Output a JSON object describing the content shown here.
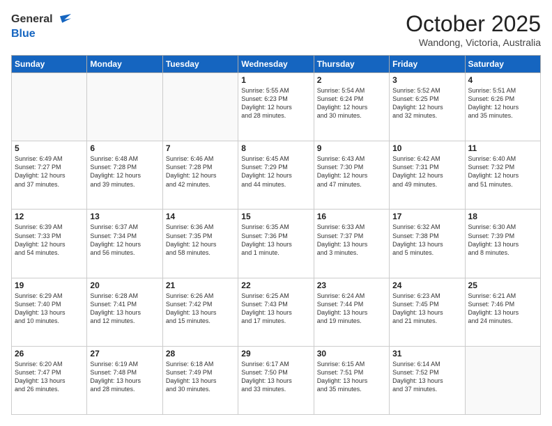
{
  "header": {
    "logo_general": "General",
    "logo_blue": "Blue",
    "month_title": "October 2025",
    "location": "Wandong, Victoria, Australia"
  },
  "days_of_week": [
    "Sunday",
    "Monday",
    "Tuesday",
    "Wednesday",
    "Thursday",
    "Friday",
    "Saturday"
  ],
  "weeks": [
    [
      {
        "day": "",
        "info": ""
      },
      {
        "day": "",
        "info": ""
      },
      {
        "day": "",
        "info": ""
      },
      {
        "day": "1",
        "info": "Sunrise: 5:55 AM\nSunset: 6:23 PM\nDaylight: 12 hours\nand 28 minutes."
      },
      {
        "day": "2",
        "info": "Sunrise: 5:54 AM\nSunset: 6:24 PM\nDaylight: 12 hours\nand 30 minutes."
      },
      {
        "day": "3",
        "info": "Sunrise: 5:52 AM\nSunset: 6:25 PM\nDaylight: 12 hours\nand 32 minutes."
      },
      {
        "day": "4",
        "info": "Sunrise: 5:51 AM\nSunset: 6:26 PM\nDaylight: 12 hours\nand 35 minutes."
      }
    ],
    [
      {
        "day": "5",
        "info": "Sunrise: 6:49 AM\nSunset: 7:27 PM\nDaylight: 12 hours\nand 37 minutes."
      },
      {
        "day": "6",
        "info": "Sunrise: 6:48 AM\nSunset: 7:28 PM\nDaylight: 12 hours\nand 39 minutes."
      },
      {
        "day": "7",
        "info": "Sunrise: 6:46 AM\nSunset: 7:28 PM\nDaylight: 12 hours\nand 42 minutes."
      },
      {
        "day": "8",
        "info": "Sunrise: 6:45 AM\nSunset: 7:29 PM\nDaylight: 12 hours\nand 44 minutes."
      },
      {
        "day": "9",
        "info": "Sunrise: 6:43 AM\nSunset: 7:30 PM\nDaylight: 12 hours\nand 47 minutes."
      },
      {
        "day": "10",
        "info": "Sunrise: 6:42 AM\nSunset: 7:31 PM\nDaylight: 12 hours\nand 49 minutes."
      },
      {
        "day": "11",
        "info": "Sunrise: 6:40 AM\nSunset: 7:32 PM\nDaylight: 12 hours\nand 51 minutes."
      }
    ],
    [
      {
        "day": "12",
        "info": "Sunrise: 6:39 AM\nSunset: 7:33 PM\nDaylight: 12 hours\nand 54 minutes."
      },
      {
        "day": "13",
        "info": "Sunrise: 6:37 AM\nSunset: 7:34 PM\nDaylight: 12 hours\nand 56 minutes."
      },
      {
        "day": "14",
        "info": "Sunrise: 6:36 AM\nSunset: 7:35 PM\nDaylight: 12 hours\nand 58 minutes."
      },
      {
        "day": "15",
        "info": "Sunrise: 6:35 AM\nSunset: 7:36 PM\nDaylight: 13 hours\nand 1 minute."
      },
      {
        "day": "16",
        "info": "Sunrise: 6:33 AM\nSunset: 7:37 PM\nDaylight: 13 hours\nand 3 minutes."
      },
      {
        "day": "17",
        "info": "Sunrise: 6:32 AM\nSunset: 7:38 PM\nDaylight: 13 hours\nand 5 minutes."
      },
      {
        "day": "18",
        "info": "Sunrise: 6:30 AM\nSunset: 7:39 PM\nDaylight: 13 hours\nand 8 minutes."
      }
    ],
    [
      {
        "day": "19",
        "info": "Sunrise: 6:29 AM\nSunset: 7:40 PM\nDaylight: 13 hours\nand 10 minutes."
      },
      {
        "day": "20",
        "info": "Sunrise: 6:28 AM\nSunset: 7:41 PM\nDaylight: 13 hours\nand 12 minutes."
      },
      {
        "day": "21",
        "info": "Sunrise: 6:26 AM\nSunset: 7:42 PM\nDaylight: 13 hours\nand 15 minutes."
      },
      {
        "day": "22",
        "info": "Sunrise: 6:25 AM\nSunset: 7:43 PM\nDaylight: 13 hours\nand 17 minutes."
      },
      {
        "day": "23",
        "info": "Sunrise: 6:24 AM\nSunset: 7:44 PM\nDaylight: 13 hours\nand 19 minutes."
      },
      {
        "day": "24",
        "info": "Sunrise: 6:23 AM\nSunset: 7:45 PM\nDaylight: 13 hours\nand 21 minutes."
      },
      {
        "day": "25",
        "info": "Sunrise: 6:21 AM\nSunset: 7:46 PM\nDaylight: 13 hours\nand 24 minutes."
      }
    ],
    [
      {
        "day": "26",
        "info": "Sunrise: 6:20 AM\nSunset: 7:47 PM\nDaylight: 13 hours\nand 26 minutes."
      },
      {
        "day": "27",
        "info": "Sunrise: 6:19 AM\nSunset: 7:48 PM\nDaylight: 13 hours\nand 28 minutes."
      },
      {
        "day": "28",
        "info": "Sunrise: 6:18 AM\nSunset: 7:49 PM\nDaylight: 13 hours\nand 30 minutes."
      },
      {
        "day": "29",
        "info": "Sunrise: 6:17 AM\nSunset: 7:50 PM\nDaylight: 13 hours\nand 33 minutes."
      },
      {
        "day": "30",
        "info": "Sunrise: 6:15 AM\nSunset: 7:51 PM\nDaylight: 13 hours\nand 35 minutes."
      },
      {
        "day": "31",
        "info": "Sunrise: 6:14 AM\nSunset: 7:52 PM\nDaylight: 13 hours\nand 37 minutes."
      },
      {
        "day": "",
        "info": ""
      }
    ]
  ]
}
